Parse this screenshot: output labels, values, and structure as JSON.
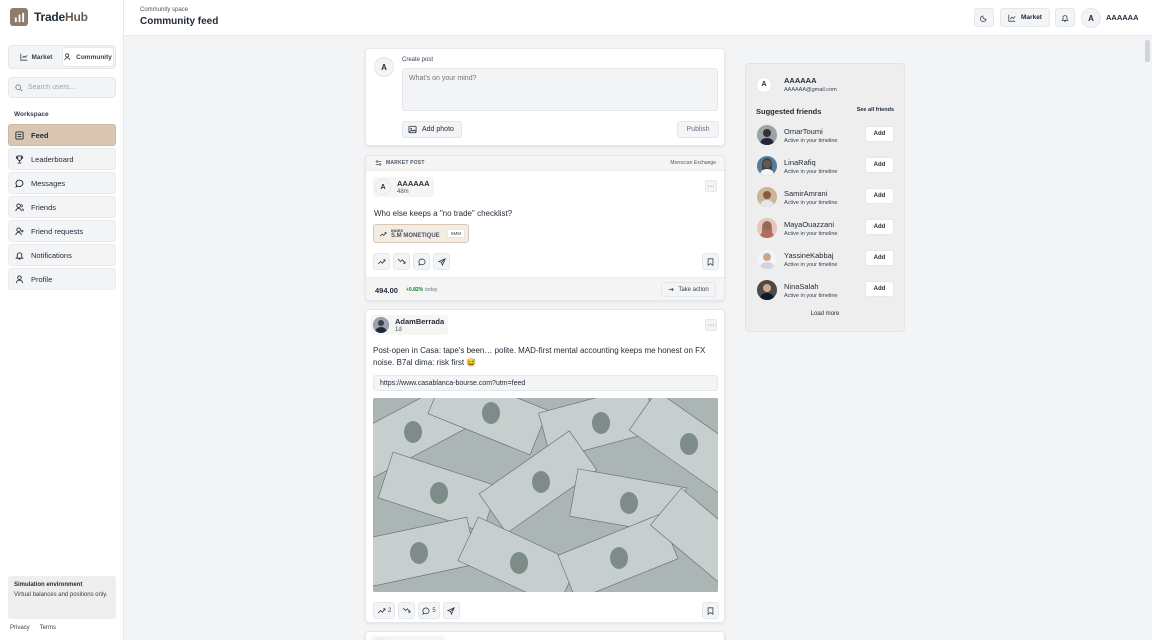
{
  "app": {
    "brand_left": "Trade",
    "brand_right": "Hub"
  },
  "sidebar": {
    "segments": [
      {
        "label": "Market"
      },
      {
        "label": "Community"
      }
    ],
    "search_placeholder": "Search users...",
    "section_label": "Workspace",
    "nav": [
      {
        "label": "Feed",
        "icon": "feed-icon",
        "active": true
      },
      {
        "label": "Leaderboard",
        "icon": "trophy-icon"
      },
      {
        "label": "Messages",
        "icon": "message-icon"
      },
      {
        "label": "Friends",
        "icon": "users-icon"
      },
      {
        "label": "Friend requests",
        "icon": "user-plus-icon"
      },
      {
        "label": "Notifications",
        "icon": "bell-icon"
      },
      {
        "label": "Profile",
        "icon": "user-icon"
      }
    ],
    "sim": {
      "title": "Simulation environment",
      "text": "Virtual balances and positions only."
    },
    "footer": {
      "privacy": "Privacy",
      "terms": "Terms"
    }
  },
  "header": {
    "breadcrumb": "Community space",
    "title": "Community feed",
    "market_label": "Market",
    "avatar_initial": "A",
    "user_name": "AAAAAA"
  },
  "composer": {
    "avatar_initial": "A",
    "label": "Create post",
    "placeholder": "What's on your mind?",
    "add_photo": "Add photo",
    "publish": "Publish"
  },
  "post1": {
    "tag": "MARKET POST",
    "exchange": "Moroccan Exchange",
    "avatar_initial": "A",
    "author": "AAAAAA",
    "time": "48m",
    "text": "Who else keeps a \"no trade\" checklist?",
    "index_small": "INDEX",
    "index_name": "S.M MONETIQUE",
    "index_badge": "5MM",
    "price": "494.00",
    "change": "+0.82%",
    "change_label": "today",
    "take_action": "Take action"
  },
  "post2": {
    "author": "AdamBerrada",
    "time": "1d",
    "text": "Post-open in Casa: tape's been… polite. MAD-first mental accounting keeps me honest on FX noise. B7al dima: risk first 😅",
    "link": "https://www.casablanca-bourse.com?utm=feed",
    "likes": "2",
    "comments": "5"
  },
  "right_panel": {
    "avatar_initial": "A",
    "name": "AAAAAA",
    "email": "AAAAAA@gmail.com",
    "suggested_label": "Suggested friends",
    "see_all": "See all friends",
    "add_label": "Add",
    "friends": [
      {
        "name": "OmarToumi",
        "status": "Active in your timeline"
      },
      {
        "name": "LinaRafiq",
        "status": "Active in your timeline"
      },
      {
        "name": "SamirAmrani",
        "status": "Active in your timeline"
      },
      {
        "name": "MayaOuazzani",
        "status": "Active in your timeline"
      },
      {
        "name": "YassineKabbaj",
        "status": "Active in your timeline"
      },
      {
        "name": "NinaSalah",
        "status": "Active in your timeline"
      }
    ],
    "load_more": "Load more"
  },
  "colors": {
    "accent": "#d9c7b4",
    "brand": "#8d7b6c",
    "positive": "#15803d"
  }
}
